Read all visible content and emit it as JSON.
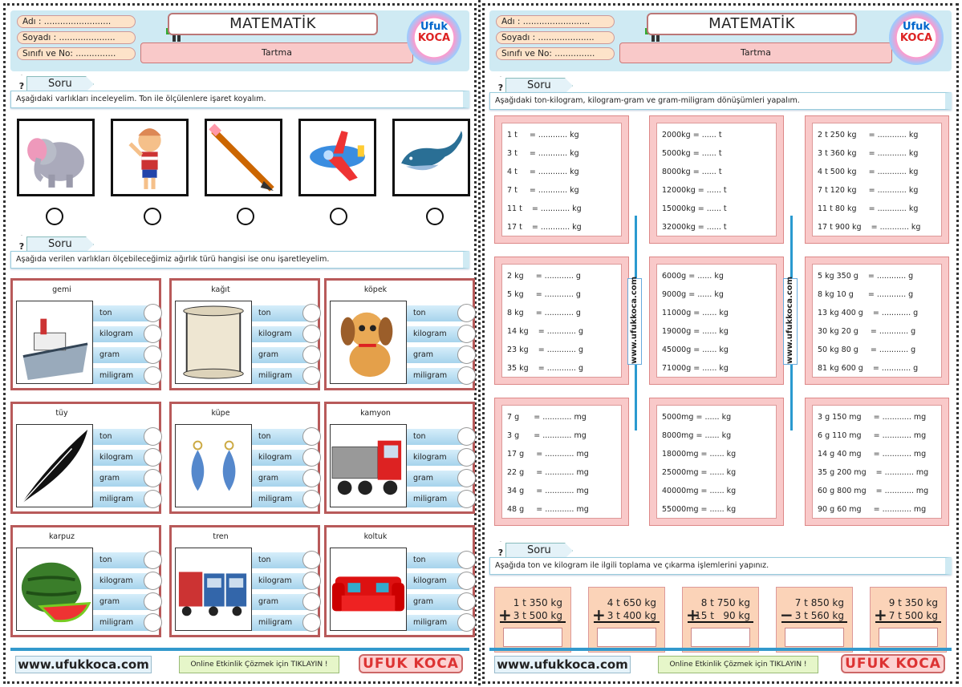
{
  "header": {
    "name_label": "Adı :",
    "surname_label": "Soyadı :",
    "class_label": "Sınıfı ve No:",
    "subject": "MATEMATİK",
    "topic": "Tartma",
    "logo_top": "Ufuk",
    "logo_bottom": "KOCA"
  },
  "page1": {
    "q1": {
      "tab": "Soru",
      "text": "Aşağıdaki varlıkları inceleyelim. Ton ile ölçülenlere işaret koyalım.",
      "items": [
        "elephant",
        "boy",
        "pencil",
        "airplane",
        "whale"
      ]
    },
    "q2": {
      "tab": "Soru",
      "text": "Aşağıda verilen varlıkları ölçebileceğimiz ağırlık türü hangisi ise onu işaretleyelim.",
      "options": [
        "ton",
        "kilogram",
        "gram",
        "miligram"
      ],
      "cards": [
        "gemi",
        "kağıt",
        "köpek",
        "tüy",
        "küpe",
        "kamyon",
        "karpuz",
        "tren",
        "koltuk"
      ]
    }
  },
  "page2": {
    "q1": {
      "tab": "Soru",
      "text": "Aşağıdaki ton-kilogram, kilogram-gram ve gram-miligram dönüşümleri yapalım.",
      "boxes": [
        [
          "1 t     = ............ kg",
          "3 t     = ............ kg",
          "4 t     = ............ kg",
          "7 t     = ............ kg",
          "11 t    = ............ kg",
          "17 t    = ............ kg"
        ],
        [
          "2000kg = ...... t",
          "5000kg = ...... t",
          "8000kg = ...... t",
          "12000kg = ...... t",
          "15000kg = ...... t",
          "32000kg = ...... t"
        ],
        [
          "2 t 250 kg     = ............ kg",
          "3 t 360 kg     = ............ kg",
          "4 t 500 kg     = ............ kg",
          "7 t 120 kg     = ............ kg",
          "11 t 80 kg     = ............ kg",
          "17 t 900 kg    = ............ kg"
        ],
        [
          "2 kg     = ............ g",
          "5 kg     = ............ g",
          "8 kg     = ............ g",
          "14 kg    = ............ g",
          "23 kg    = ............ g",
          "35 kg    = ............ g"
        ],
        [
          "6000g = ...... kg",
          "9000g = ...... kg",
          "11000g = ...... kg",
          "19000g = ...... kg",
          "45000g = ...... kg",
          "71000g = ...... kg"
        ],
        [
          "5 kg 350 g    = ............ g",
          "8 kg 10 g      = ............ g",
          "13 kg 400 g    = ............ g",
          "30 kg 20 g     = ............ g",
          "50 kg 80 g     = ............ g",
          "81 kg 600 g    = ............ g"
        ],
        [
          "7 g      = ............ mg",
          "3 g      = ............ mg",
          "17 g     = ............ mg",
          "22 g     = ............ mg",
          "34 g     = ............ mg",
          "48 g     = ............ mg"
        ],
        [
          "5000mg = ...... kg",
          "8000mg = ...... kg",
          "18000mg = ...... kg",
          "25000mg = ...... kg",
          "40000mg = ...... kg",
          "55000mg = ...... kg"
        ],
        [
          "3 g 150 mg     = ............ mg",
          "6 g 110 mg     = ............ mg",
          "14 g 40 mg     = ............ mg",
          "35 g 200 mg    = ............ mg",
          "60 g 800 mg    = ............ mg",
          "90 g 60 mg     = ............ mg"
        ]
      ],
      "vertical_tag": "www.ufukkoca.com"
    },
    "q2": {
      "tab": "Soru",
      "text": "Aşağıda ton ve kilogram ile ilgili toplama ve çıkarma işlemlerini yapınız.",
      "ops": [
        {
          "a": "1 t 350 kg",
          "b": "3 t 500 kg",
          "op": "+"
        },
        {
          "a": "4 t 650 kg",
          "b": "3 t 400 kg",
          "op": "+"
        },
        {
          "a": "8 t 750 kg",
          "b": "15 t   90 kg",
          "op": "+"
        },
        {
          "a": "7 t 850 kg",
          "b": "3 t 560 kg",
          "op": "−"
        },
        {
          "a": "9 t 350 kg",
          "b": "7 t 500 kg",
          "op": "+"
        }
      ]
    }
  },
  "footer": {
    "website": "www.ufukkoca.com",
    "online": "Online Etkinlik Çözmek için TIKLAYIN !",
    "brand": "UFUK KOCA"
  }
}
